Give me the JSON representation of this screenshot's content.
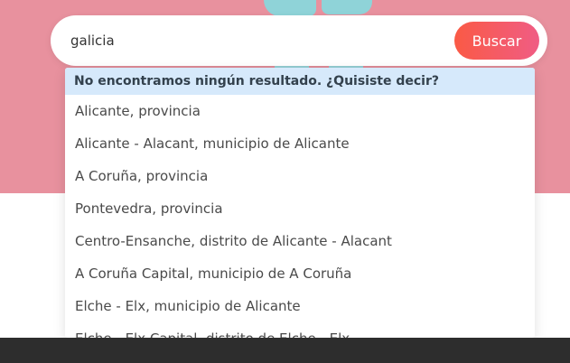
{
  "search": {
    "value": "galicia",
    "button_label": "Buscar"
  },
  "dropdown": {
    "header": "No encontramos ningún resultado. ¿Quisiste decir?",
    "suggestions": [
      "Alicante, provincia",
      "Alicante - Alacant, municipio de Alicante",
      "A Coruña, provincia",
      "Pontevedra, provincia",
      "Centro-Ensanche, distrito de Alicante - Alacant",
      "A Coruña Capital, municipio de A Coruña",
      "Elche - Elx, municipio de Alicante",
      "Elche - Elx Capital, distrito de Elche - Elx"
    ]
  },
  "colors": {
    "hero_background": "#e8919e",
    "button_gradient_start": "#fa5a45",
    "button_gradient_end": "#f05c84",
    "dropdown_header_background": "#d6e9fb",
    "footer_bar": "#2d2d2d"
  }
}
